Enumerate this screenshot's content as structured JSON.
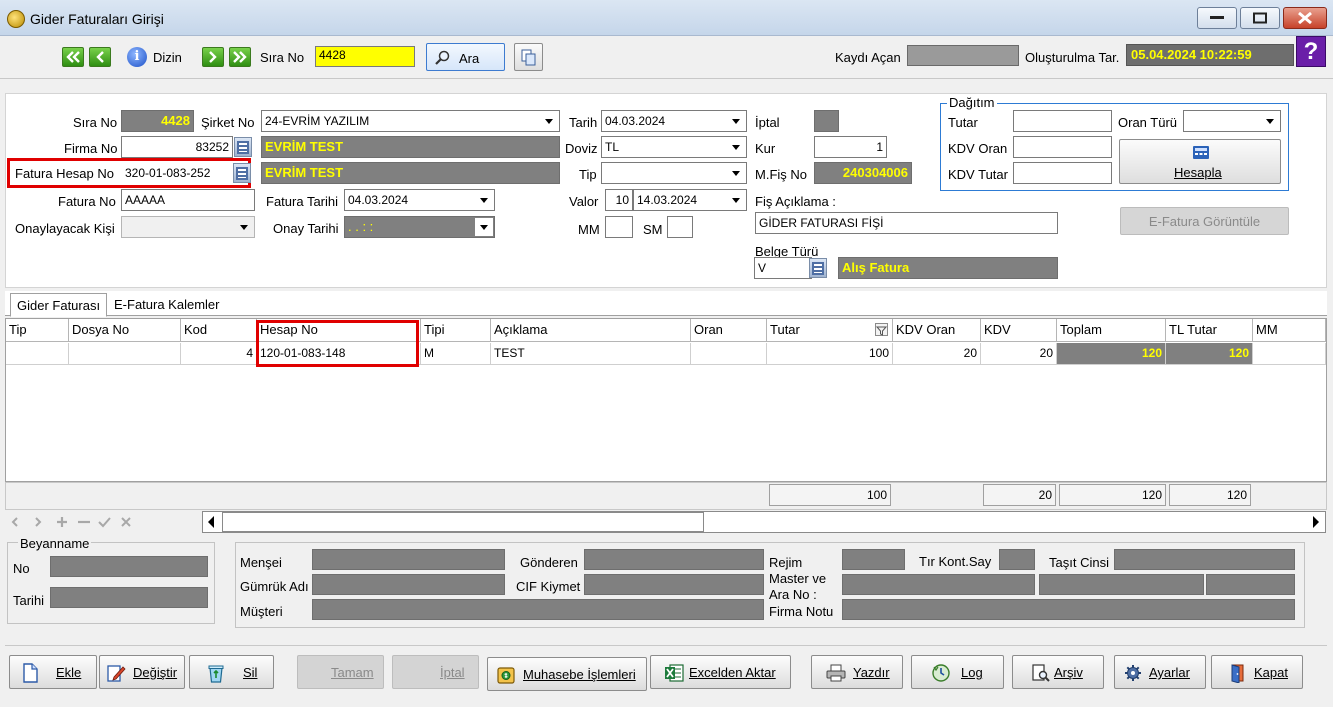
{
  "window": {
    "title": "Gider Faturaları Girişi"
  },
  "toolbar": {
    "dizin_label": "Dizin",
    "sira_no_label": "Sıra No",
    "sira_no_value": "4428",
    "ara_label": "Ara",
    "kaydi_acan_label": "Kaydı Açan",
    "olusturulma_label": "Oluşturulma Tar.",
    "olusturulma_value": "05.04.2024 10:22:59"
  },
  "form": {
    "sira_no_label": "Sıra No",
    "sira_no_value": "4428",
    "sirket_no_label": "Şirket No",
    "sirket_no_value": "24-EVRİM YAZILIM",
    "firma_no_label": "Firma No",
    "firma_no_value": "83252",
    "firma_name": "EVRİM TEST",
    "fatura_hesap_label": "Fatura Hesap No",
    "fatura_hesap_value": "320-01-083-252",
    "fatura_hesap_name": "EVRİM TEST",
    "fatura_no_label": "Fatura No",
    "fatura_no_value": "AAAAA",
    "fatura_tarihi_label": "Fatura Tarihi",
    "fatura_tarihi_value": "04.03.2024",
    "onaylayacak_label": "Onaylayacak Kişi",
    "onay_tarihi_label": "Onay Tarihi",
    "onay_tarihi_value": " .  .      :  :",
    "tarih_label": "Tarih",
    "tarih_value": "04.03.2024",
    "doviz_label": "Doviz",
    "doviz_value": "TL",
    "tip_label": "Tip",
    "valor_label": "Valor",
    "valor_days": "10",
    "valor_date": "14.03.2024",
    "mm_label": "MM",
    "sm_label": "SM",
    "iptal_label": "İptal",
    "kur_label": "Kur",
    "kur_value": "1",
    "mfis_label": "M.Fiş No",
    "mfis_value": "240304006",
    "fis_aciklama_label": "Fiş Açıklama :",
    "fis_aciklama_value": "GİDER FATURASI FİŞİ",
    "belge_turu_label": "Belge Türü",
    "belge_turu_value": "V",
    "belge_turu_name": "Alış Fatura"
  },
  "dagitim": {
    "title": "Dağıtım",
    "tutar_label": "Tutar",
    "oran_turu_label": "Oran Türü",
    "kdv_oran_label": "KDV Oran",
    "kdv_tutar_label": "KDV Tutar",
    "hesapla_label": "Hesapla"
  },
  "efatura_button": "E-Fatura Görüntüle",
  "tabs": [
    {
      "label": "Gider Faturası"
    },
    {
      "label": "E-Fatura Kalemler"
    }
  ],
  "grid": {
    "headers": [
      "Tip",
      "Dosya No",
      "Kod",
      "Hesap No",
      "Tipi",
      "Açıklama",
      "Oran",
      "Tutar",
      "KDV Oran",
      "KDV",
      "Toplam",
      "TL Tutar",
      "MM"
    ],
    "rows": [
      {
        "tip": "",
        "dosya_no": "",
        "kod": "4",
        "hesap_no": "120-01-083-148",
        "tipi": "M",
        "aciklama": "TEST",
        "oran": "",
        "tutar": "100",
        "kdv_oran": "20",
        "kdv": "20",
        "toplam": "120",
        "tl_tutar": "120",
        "mm": ""
      }
    ],
    "totals": {
      "tutar": "100",
      "kdv": "20",
      "toplam": "120",
      "tl_tutar": "120"
    }
  },
  "beyanname": {
    "title": "Beyanname",
    "no_label": "No",
    "tarihi_label": "Tarihi"
  },
  "info": {
    "mensei": "Menşei",
    "gumruk_adi": "Gümrük Adı",
    "musteri": "Müşteri",
    "gonderen": "Gönderen",
    "cif_kiymet": "CIF Kiymet",
    "rejim": "Rejim",
    "tir_kont_say": "Tır Kont.Say",
    "tasit_cinsi": "Taşıt Cinsi",
    "master_ara_no_1": "Master ve",
    "master_ara_no_2": "Ara No :",
    "firma_notu": "Firma Notu"
  },
  "buttons": {
    "ekle": "Ekle",
    "degistir": "Değiştir",
    "sil": "Sil",
    "tamam": "Tamam",
    "iptal": "İptal",
    "muhasebe": "Muhasebe İşlemleri",
    "excelden": "Excelden Aktar",
    "yazdir": "Yazdır",
    "log": "Log",
    "arsiv": "Arşiv",
    "ayarlar": "Ayarlar",
    "kapat": "Kapat"
  }
}
